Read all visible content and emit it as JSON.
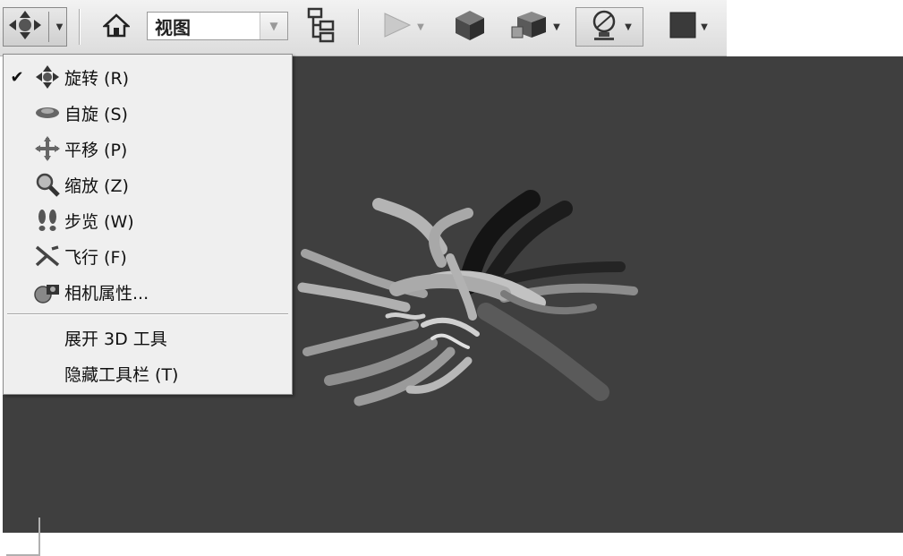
{
  "toolbar": {
    "view_select_value": "视图",
    "icons": [
      "navigate-icon",
      "home-icon",
      "model-tree-icon",
      "play-icon",
      "cube-icon",
      "render-cube-icon",
      "light-icon",
      "background-color-icon"
    ],
    "colors": {
      "toolbar_bg": "#dcdcdc",
      "viewport_bg": "#3f3f3f"
    }
  },
  "menu": {
    "items": [
      {
        "label": "旋转 (R)",
        "checked": true,
        "icon": "rotate-icon"
      },
      {
        "label": "自旋 (S)",
        "checked": false,
        "icon": "spin-icon"
      },
      {
        "label": "平移 (P)",
        "checked": false,
        "icon": "pan-icon"
      },
      {
        "label": "缩放 (Z)",
        "checked": false,
        "icon": "zoom-icon"
      },
      {
        "label": "步览 (W)",
        "checked": false,
        "icon": "walk-icon"
      },
      {
        "label": "飞行 (F)",
        "checked": false,
        "icon": "fly-icon"
      },
      {
        "label": "相机属性...",
        "checked": false,
        "icon": "camera-properties-icon"
      }
    ],
    "extra_items": [
      {
        "label": "展开 3D 工具"
      },
      {
        "label": "隐藏工具栏 (T)"
      }
    ],
    "check_glyph": "✔"
  }
}
